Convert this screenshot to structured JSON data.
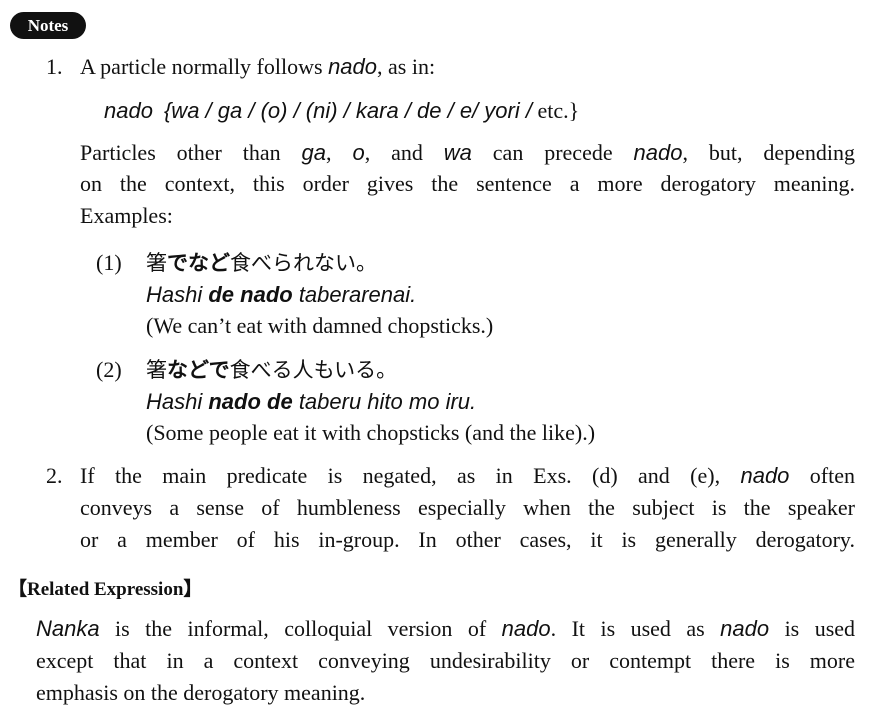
{
  "badge": "Notes",
  "note1": {
    "num": "1.",
    "intro_a": "A particle normally follows ",
    "intro_nado": "nado",
    "intro_b": ", as in:",
    "pattern_nado": "nado",
    "pattern_list": "{wa / ga / (o) / (ni) / kara / de / e/ yori /",
    "pattern_etc": "etc.}",
    "para_l1_a": "Particles other than ",
    "para_l1_ga": "ga",
    "para_l1_sep1": ", ",
    "para_l1_o": "o",
    "para_l1_sep2": ", and ",
    "para_l1_wa": "wa",
    "para_l1_b": " can precede ",
    "para_l1_nado": "nado",
    "para_l1_c": ", but, depending",
    "para_l2": "on the context, this order gives the sentence a more derogatory meaning.",
    "para_l3": "Examples:"
  },
  "examples": [
    {
      "num": "(1)",
      "jp_a": "箸",
      "jp_b": "でなど",
      "jp_c": "食べられない。",
      "rom_a": "Hashi ",
      "rom_b": "de nado",
      "rom_c": " taberarenai.",
      "en": "(We can’t eat with damned chopsticks.)"
    },
    {
      "num": "(2)",
      "jp_a": "箸",
      "jp_b": "などで",
      "jp_c": "食べる人もいる。",
      "rom_a": "Hashi ",
      "rom_b": "nado de",
      "rom_c": " taberu hito mo iru.",
      "en": "(Some people eat it with chopsticks (and the like).)"
    }
  ],
  "note2": {
    "num": "2.",
    "l1_a": "If the main predicate is negated, as in Exs. (d) and (e), ",
    "l1_nado": "nado",
    "l1_b": " often",
    "l2": "conveys a sense of humbleness especially when the subject is the speaker",
    "l3": "or a member of his in-group.  In other cases, it is generally derogatory."
  },
  "related": {
    "heading": "【Related Expression】",
    "l1_nanka": "Nanka",
    "l1_a": " is the informal, colloquial version of ",
    "l1_nado": "nado",
    "l1_b": ".  It is used as ",
    "l1_nado2": "nado",
    "l1_c": " is used",
    "l2": "except that in a context conveying undesirability or contempt there is more",
    "l3": "emphasis on the derogatory meaning."
  }
}
